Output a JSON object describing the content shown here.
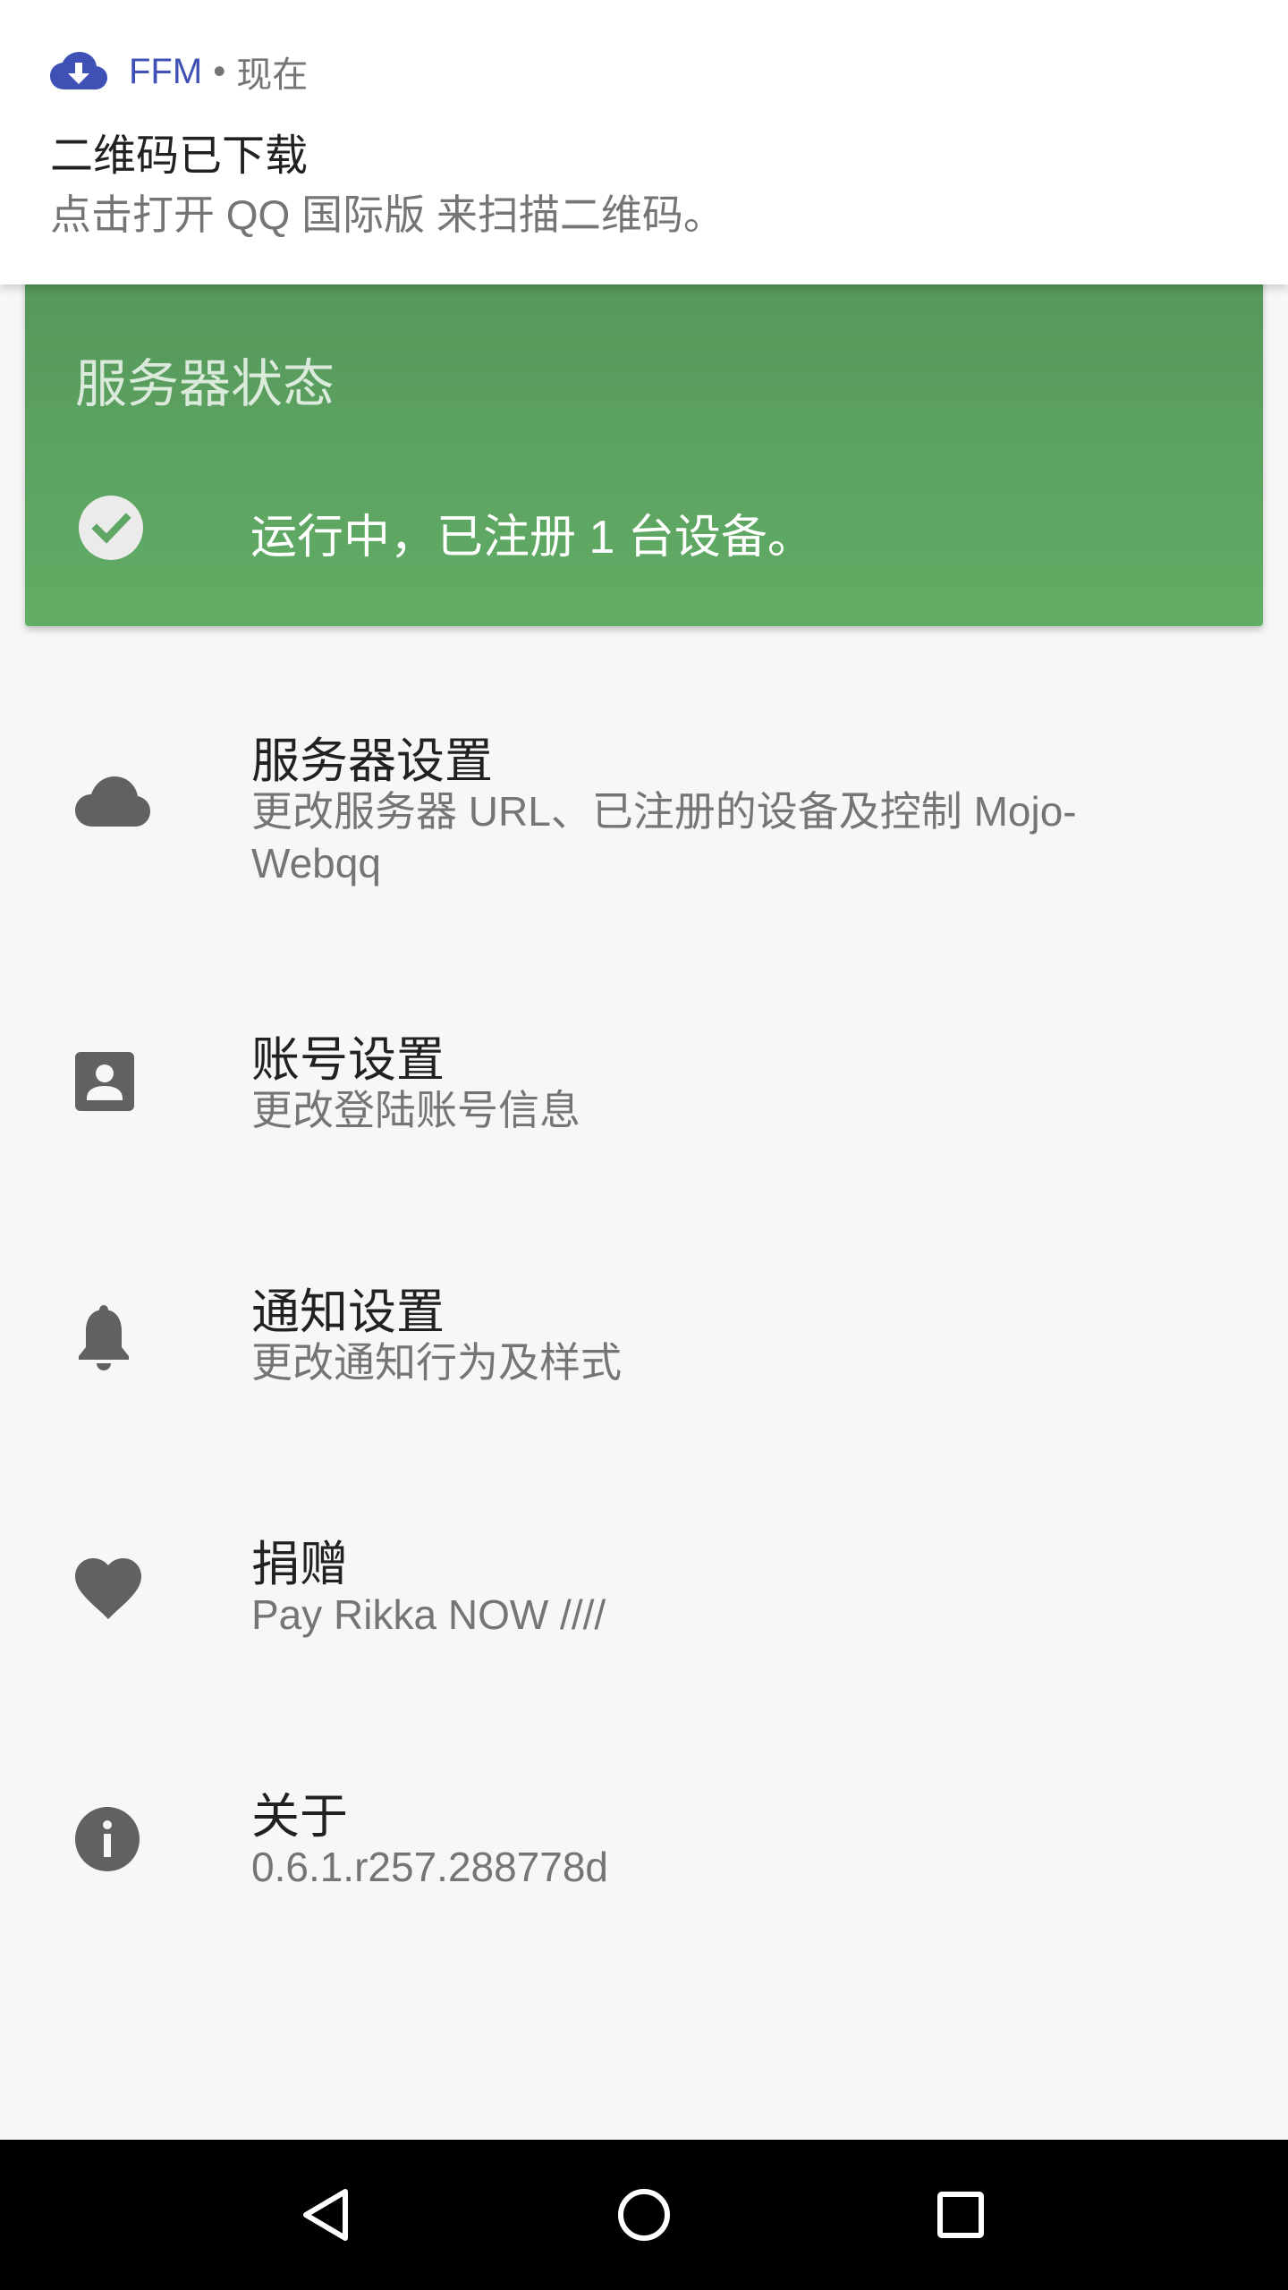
{
  "notification": {
    "app_name": "FFM",
    "separator": "•",
    "time": "现在",
    "title": "二维码已下载",
    "text": "点击打开 QQ 国际版 来扫描二维码。",
    "icon": "cloud-download-icon",
    "accent_color": "#3f51b5"
  },
  "status_card": {
    "title": "服务器状态",
    "status_text": "运行中，已注册 1 台设备。",
    "icon": "check-circle-icon",
    "background_color": "#5fa763"
  },
  "settings": [
    {
      "title": "服务器设置",
      "summary": "更改服务器 URL、已注册的设备及控制 Mojo-Webqq",
      "icon": "cloud-icon"
    },
    {
      "title": "账号设置",
      "summary": "更改登陆账号信息",
      "icon": "account-box-icon"
    },
    {
      "title": "通知设置",
      "summary": "更改通知行为及样式",
      "icon": "bell-icon"
    },
    {
      "title": "捐赠",
      "summary": "Pay Rikka NOW ////",
      "icon": "heart-icon"
    },
    {
      "title": "关于",
      "summary": "0.6.1.r257.288778d",
      "icon": "info-icon"
    }
  ],
  "nav_bar": {
    "back_icon": "back-triangle-icon",
    "home_icon": "home-circle-icon",
    "recents_icon": "recents-square-icon"
  }
}
